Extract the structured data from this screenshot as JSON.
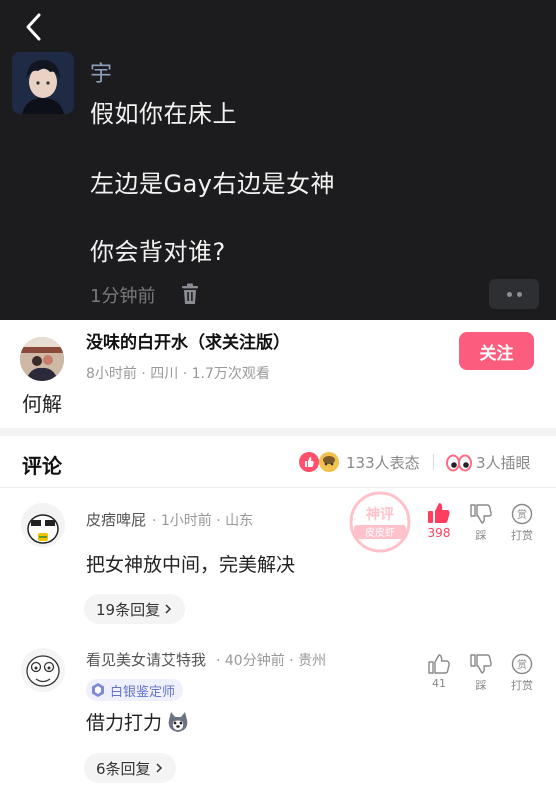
{
  "post": {
    "author": "宇",
    "lines": [
      "假如你在床上",
      "左边是Gay右边是女神",
      "你会背对谁?"
    ],
    "time": "1分钟前"
  },
  "uploader": {
    "name": "没味的白开水（求关注版）",
    "meta": "8小时前 · 四川 · 1.7万次观看",
    "follow_label": "关注",
    "caption": "何解"
  },
  "comments_header": {
    "title": "评论",
    "reactions_text": "133人表态",
    "insert_eyes_text": "3人插眼"
  },
  "comments": [
    {
      "user": "皮痞啤屁",
      "sub": " · 1小时前 · 山东",
      "text": "把女神放中间，完美解决",
      "replies": "19条回复",
      "like_count": "398",
      "dislike_label": "踩",
      "tip_label": "打赏",
      "stamp_top": "神评",
      "stamp_bottom": "皮皮虾"
    },
    {
      "user": "看见美女请艾特我",
      "sub": " · 40分钟前 · 贵州",
      "badge": "白银鉴定师",
      "text": "借力打力",
      "replies": "6条回复",
      "like_count": "41",
      "dislike_label": "踩",
      "tip_label": "打赏"
    }
  ],
  "colors": {
    "dark_bg": "#1c1c1e",
    "follow_button": "#fc5c7d",
    "like_active": "#ff3d5e",
    "badge_text": "#6673c8"
  }
}
